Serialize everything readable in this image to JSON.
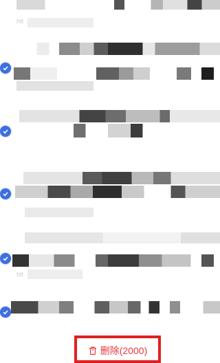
{
  "colors": {
    "accent": "#3d6fe0",
    "danger": "#e5393f",
    "highlight_box": "#e02020"
  },
  "list": {
    "items": [
      {
        "selected": true,
        "meta": "htt"
      },
      {
        "selected": true,
        "meta": ""
      },
      {
        "selected": true,
        "meta": ""
      },
      {
        "selected": true,
        "meta": ""
      },
      {
        "selected": true,
        "meta": "htt"
      },
      {
        "selected": true,
        "meta": ""
      }
    ]
  },
  "footer": {
    "delete_label": "删除(2000)",
    "delete_icon": "trash-icon"
  }
}
